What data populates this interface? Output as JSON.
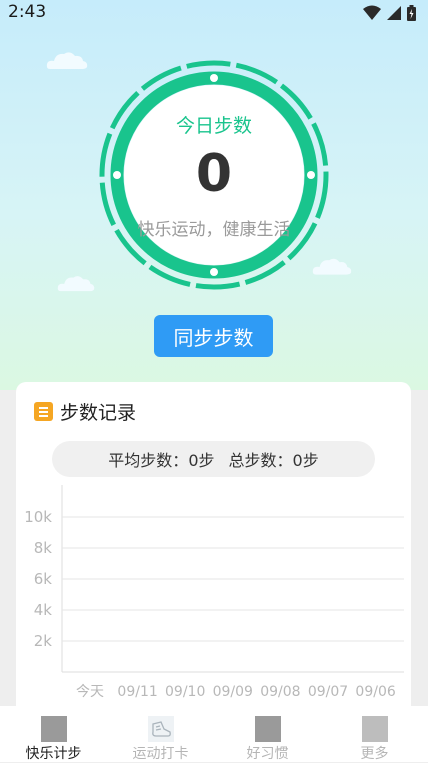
{
  "status_bar": {
    "time": "2:43"
  },
  "ring": {
    "title": "今日步数",
    "count": "0",
    "slogan": "快乐运动，健康生活"
  },
  "sync_button": {
    "label": "同步步数"
  },
  "record_card": {
    "title": "步数记录",
    "avg_label": "平均步数：",
    "avg_value": "0步",
    "total_label": "总步数：",
    "total_value": "0步"
  },
  "chart_data": {
    "type": "bar",
    "title": "",
    "xlabel": "",
    "ylabel": "",
    "categories": [
      "今天",
      "09/11",
      "09/10",
      "09/09",
      "09/08",
      "09/07",
      "09/06"
    ],
    "values": [
      0,
      0,
      0,
      0,
      0,
      0,
      0
    ],
    "y_ticks": [
      "2k",
      "4k",
      "6k",
      "8k",
      "10k"
    ],
    "ylim": [
      0,
      11000
    ],
    "grid": true
  },
  "tab_bar": {
    "tabs": [
      {
        "label": "快乐计步",
        "icon": "walk-tab-icon",
        "active": true
      },
      {
        "label": "运动打卡",
        "icon": "sneaker-tab-icon",
        "active": false
      },
      {
        "label": "好习惯",
        "icon": "habit-tab-icon",
        "active": false
      },
      {
        "label": "更多",
        "icon": "more-tab-icon",
        "active": false
      }
    ]
  },
  "colors": {
    "accent_green": "#19c48d",
    "button_blue": "#2f9bf5",
    "card_icon_orange": "#f5a623"
  }
}
